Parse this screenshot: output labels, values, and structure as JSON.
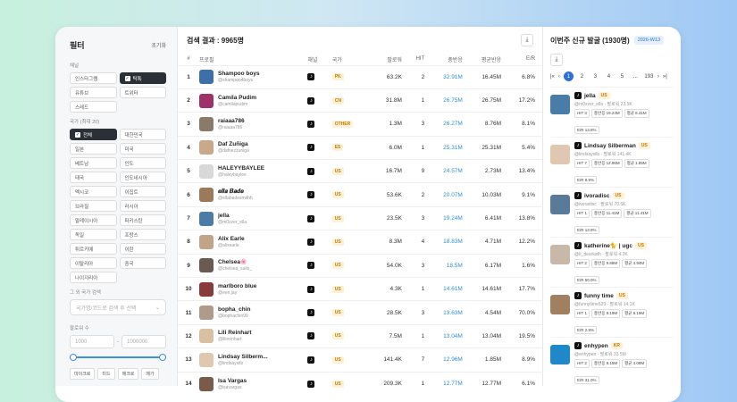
{
  "filter": {
    "title": "필터",
    "reset": "초기화",
    "platform_label": "채널",
    "platforms": [
      {
        "label": "인스타그램",
        "on": false
      },
      {
        "label": "틱톡",
        "on": true
      },
      {
        "label": "유튜브",
        "on": false
      },
      {
        "label": "트위터",
        "on": false
      },
      {
        "label": "스레드",
        "on": false
      }
    ],
    "country_label": "국가 (최대 20)",
    "countries": [
      {
        "label": "전체",
        "on": true
      },
      {
        "label": "대한민국",
        "on": false
      },
      {
        "label": "일본",
        "on": false
      },
      {
        "label": "미국",
        "on": false
      },
      {
        "label": "베트남",
        "on": false
      },
      {
        "label": "인도",
        "on": false
      },
      {
        "label": "태국",
        "on": false
      },
      {
        "label": "인도네시아",
        "on": false
      },
      {
        "label": "멕시코",
        "on": false
      },
      {
        "label": "이집트",
        "on": false
      },
      {
        "label": "브라질",
        "on": false
      },
      {
        "label": "러시아",
        "on": false
      },
      {
        "label": "말레이시아",
        "on": false
      },
      {
        "label": "파키스탄",
        "on": false
      },
      {
        "label": "독일",
        "on": false
      },
      {
        "label": "프랑스",
        "on": false
      },
      {
        "label": "튀르키예",
        "on": false
      },
      {
        "label": "이란",
        "on": false
      },
      {
        "label": "이탈리아",
        "on": false
      },
      {
        "label": "중국",
        "on": false
      },
      {
        "label": "나이지리아",
        "on": false
      }
    ],
    "other_country_label": "그 외 국가 검색",
    "other_country_placeholder": "국가명/코드로 검색 후 선택",
    "followers_label": "팔로워 수",
    "min": "1000",
    "max": "1000000",
    "sep": "-",
    "tags": [
      "마이크로",
      "미드",
      "매크로",
      "메가"
    ]
  },
  "main": {
    "title": "검색 결과 : 9965명",
    "download_icon": "⤓",
    "columns": [
      "#",
      "프로필",
      "채널",
      "국가",
      "팔로워",
      "HIT",
      "총반응",
      "평균반응",
      "E/R"
    ],
    "rows": [
      {
        "rank": "1",
        "name": "Shampoo boys",
        "handle": "@shampoo4boys",
        "country": "PK",
        "followers": "63.2K",
        "hit": "2",
        "total": "32.91M",
        "avg": "16.45M",
        "er": "6.8%",
        "color": "#3d6fa8"
      },
      {
        "rank": "2",
        "name": "Camila Pudim",
        "handle": "@camilapudim",
        "country": "CN",
        "followers": "31.8M",
        "hit": "1",
        "total": "26.75M",
        "avg": "26.75M",
        "er": "17.2%",
        "color": "#a0306a"
      },
      {
        "rank": "3",
        "name": "raiaaa786",
        "handle": "@raiaaa786",
        "country": "OTHER",
        "followers": "1.3M",
        "hit": "3",
        "total": "26.27M",
        "avg": "8.76M",
        "er": "8.1%",
        "color": "#8a7a6a"
      },
      {
        "rank": "4",
        "name": "Daf Zuñiga",
        "handle": "@dafnezzuniga",
        "country": "ES",
        "followers": "6.0M",
        "hit": "1",
        "total": "25.31M",
        "avg": "25.31M",
        "er": "5.4%",
        "color": "#c9a98a"
      },
      {
        "rank": "5",
        "name": "HALEYYBAYLEE",
        "handle": "@haleybaylee",
        "country": "US",
        "followers": "16.7M",
        "hit": "9",
        "total": "24.57M",
        "avg": "2.73M",
        "er": "13.4%",
        "color": "#d8d8d8"
      },
      {
        "rank": "6",
        "name": "𝒆𝒍𝒍𝒂 𝑩𝒂𝒅𝒆",
        "handle": "@ellabadesmithh",
        "country": "US",
        "followers": "53.6K",
        "hit": "2",
        "total": "20.07M",
        "avg": "10.03M",
        "er": "9.1%",
        "color": "#9a7a5a"
      },
      {
        "rank": "7",
        "name": "jella",
        "handle": "@m0zzer_ella",
        "country": "US",
        "followers": "23.5K",
        "hit": "3",
        "total": "19.24M",
        "avg": "6.41M",
        "er": "13.8%",
        "color": "#4a7ca8"
      },
      {
        "rank": "8",
        "name": "Alix Earle",
        "handle": "@alixearle",
        "country": "US",
        "followers": "8.3M",
        "hit": "4",
        "total": "18.83M",
        "avg": "4.71M",
        "er": "12.2%",
        "color": "#c2a488"
      },
      {
        "rank": "9",
        "name": "Chelsea🌸",
        "handle": "@chelsea_suits_",
        "country": "US",
        "followers": "54.0K",
        "hit": "3",
        "total": "18.5M",
        "avg": "6.17M",
        "er": "1.6%",
        "color": "#6a5a52"
      },
      {
        "rank": "10",
        "name": "marlboro blue",
        "handle": "@eeri.jay",
        "country": "US",
        "followers": "4.3K",
        "hit": "1",
        "total": "14.61M",
        "avg": "14.61M",
        "er": "17.7%",
        "color": "#8a3a3a"
      },
      {
        "rank": "11",
        "name": "bopha_chin",
        "handle": "@bophachin99",
        "country": "US",
        "followers": "28.5K",
        "hit": "3",
        "total": "13.63M",
        "avg": "4.54M",
        "er": "70.0%",
        "color": "#b09a8a"
      },
      {
        "rank": "12",
        "name": "Lili Reinhart",
        "handle": "@lilireinhart",
        "country": "US",
        "followers": "7.5M",
        "hit": "1",
        "total": "13.04M",
        "avg": "13.04M",
        "er": "19.5%",
        "color": "#d8c0a0"
      },
      {
        "rank": "13",
        "name": "Lindsay Silberm...",
        "handle": "@lindsaysilb",
        "country": "US",
        "followers": "141.4K",
        "hit": "7",
        "total": "12.96M",
        "avg": "1.85M",
        "er": "8.9%",
        "color": "#e0c8b0"
      },
      {
        "rank": "14",
        "name": "Isa Vargas",
        "handle": "@isavargas",
        "country": "US",
        "followers": "209.3K",
        "hit": "1",
        "total": "12.77M",
        "avg": "12.77M",
        "er": "6.1%",
        "color": "#7a5a4a"
      }
    ]
  },
  "side": {
    "title": "이번주 신규 발굴 (1930명)",
    "week": "2026-W13",
    "download_icon": "⤓",
    "pager": {
      "first": "|«",
      "prev": "‹",
      "pages": [
        "1",
        "2",
        "3",
        "4",
        "5",
        "...",
        "193"
      ],
      "next": "›",
      "last": "»|",
      "active": "1"
    },
    "cards": [
      {
        "name": "jella",
        "cc": "US",
        "sub": "@m0zzer_ella · 팔로워 23.5K",
        "hit": "HIT 3",
        "total": "총반응 19.24M",
        "avg": "평균 6.41M",
        "er": "E/R 13.8%",
        "color": "#4a7ca8"
      },
      {
        "name": "Lindsay Silberman",
        "cc": "US",
        "sub": "@lindsaysilb · 팔로워 141.4K",
        "hit": "HIT 7",
        "total": "총반응 12.96M",
        "avg": "평균 1.85M",
        "er": "E/R 8.9%",
        "color": "#e0c8b0"
      },
      {
        "name": "ivoradisc",
        "cc": "US",
        "sub": "@ivoradisc · 팔로워 70.5K",
        "hit": "HIT 1",
        "total": "총반응 11.41M",
        "avg": "평균 11.41M",
        "er": "E/R 13.9%",
        "color": "#5a7a9a"
      },
      {
        "name": "katherine🐈 | ugc",
        "cc": "US",
        "sub": "@k_dearkath · 팔로워 4.2K",
        "hit": "HIT 2",
        "total": "총반응 9.88M",
        "avg": "평균 4.94M",
        "er": "E/R 50.0%",
        "color": "#c8b8a8"
      },
      {
        "name": "funny time",
        "cc": "US",
        "sub": "@funnytime529 · 팔로워 14.1K",
        "hit": "HIT 1",
        "total": "총반응 8.19M",
        "avg": "평균 8.19M",
        "er": "E/R 2.8%",
        "color": "#a08060"
      },
      {
        "name": "enhypen",
        "cc": "KR",
        "sub": "@enhypen · 팔로워 33.5M",
        "hit": "HIT 2",
        "total": "총반응 8.15M",
        "avg": "평균 4.08M",
        "er": "E/R 31.0%",
        "color": "#1e88c8"
      }
    ]
  }
}
